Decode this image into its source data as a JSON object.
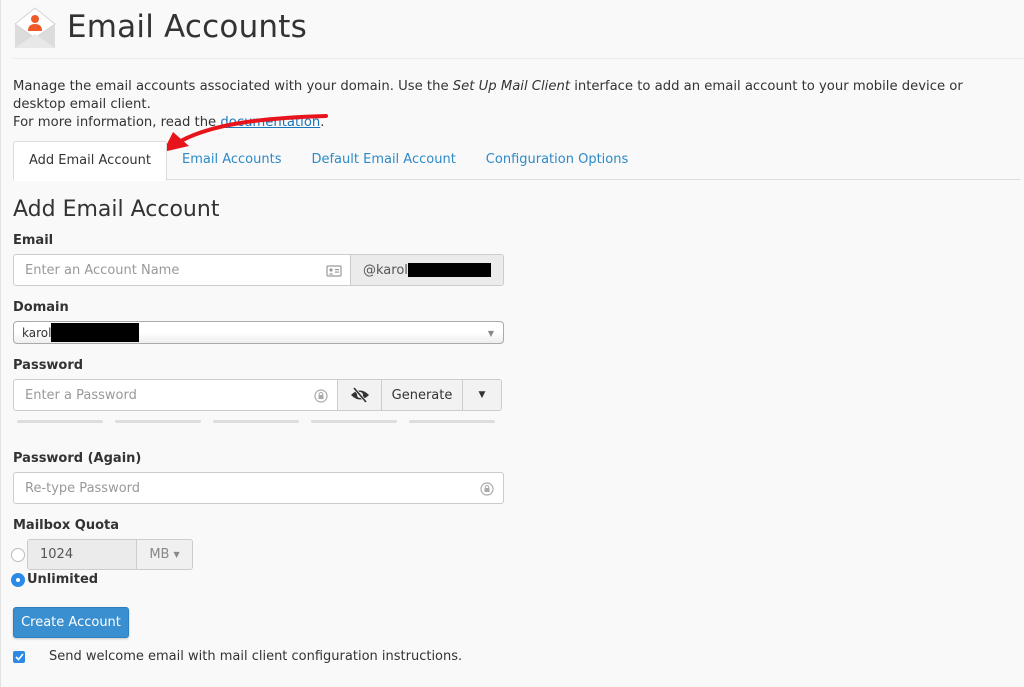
{
  "header": {
    "title": "Email Accounts",
    "icon": "email-accounts-icon"
  },
  "description": {
    "part1": "Manage the email accounts associated with your domain. Use the ",
    "emphasis": "Set Up Mail Client",
    "part2": " interface to add an email account to your mobile device or desktop email client.",
    "line2_prefix": "For more information, read the ",
    "link_text": "documentation",
    "line2_suffix": "."
  },
  "annotation": {
    "arrow_color": "#e8141b",
    "points_to": "Add Email Account tab"
  },
  "tabs": [
    {
      "label": "Add Email Account",
      "active": true
    },
    {
      "label": "Email Accounts",
      "active": false
    },
    {
      "label": "Default Email Account",
      "active": false
    },
    {
      "label": "Configuration Options",
      "active": false
    }
  ],
  "form": {
    "section_title": "Add Email Account",
    "email": {
      "label": "Email",
      "placeholder": "Enter an Account Name",
      "value": "",
      "domain_suffix": "@karol",
      "icon": "contact-card-icon"
    },
    "domain": {
      "label": "Domain",
      "selected": "karol"
    },
    "password": {
      "label": "Password",
      "placeholder": "Enter a Password",
      "value": "",
      "toggle_icon": "eye-slash-icon",
      "generate_label": "Generate",
      "strength_segments": 5,
      "strength_filled": 0
    },
    "password_again": {
      "label": "Password (Again)",
      "placeholder": "Re-type Password",
      "value": ""
    },
    "quota": {
      "label": "Mailbox Quota",
      "value": "1024",
      "unit": "MB",
      "unlimited_label": "Unlimited",
      "selected": "unlimited"
    },
    "submit_label": "Create Account",
    "welcome_email": {
      "label": "Send welcome email with mail client configuration instructions.",
      "checked": true
    }
  },
  "colors": {
    "accent": "#3a8fd0",
    "link": "#2d8ac7",
    "icon_orange": "#f05a28",
    "radio_checked": "#2b8ae6"
  }
}
